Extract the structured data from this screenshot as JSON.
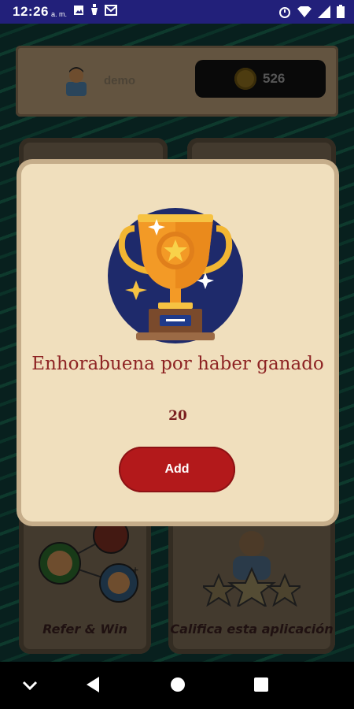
{
  "status_bar": {
    "time": "12:26",
    "ampm": "a. m.",
    "icons": [
      "image-icon",
      "lamp-icon",
      "mail-icon",
      "alarm-icon",
      "wifi-icon",
      "signal-icon",
      "battery-icon"
    ]
  },
  "header": {
    "username": "demo",
    "coins": "526"
  },
  "cards": {
    "refer_label": "Refer & Win",
    "rate_label": "Califica esta aplicación"
  },
  "dialog": {
    "title": "Enhorabuena por haber ganado",
    "amount": "20",
    "button_label": "Add"
  },
  "colors": {
    "accent_red": "#b3191b",
    "dialog_bg": "#f0dfbd",
    "status_bar": "#22207a"
  }
}
